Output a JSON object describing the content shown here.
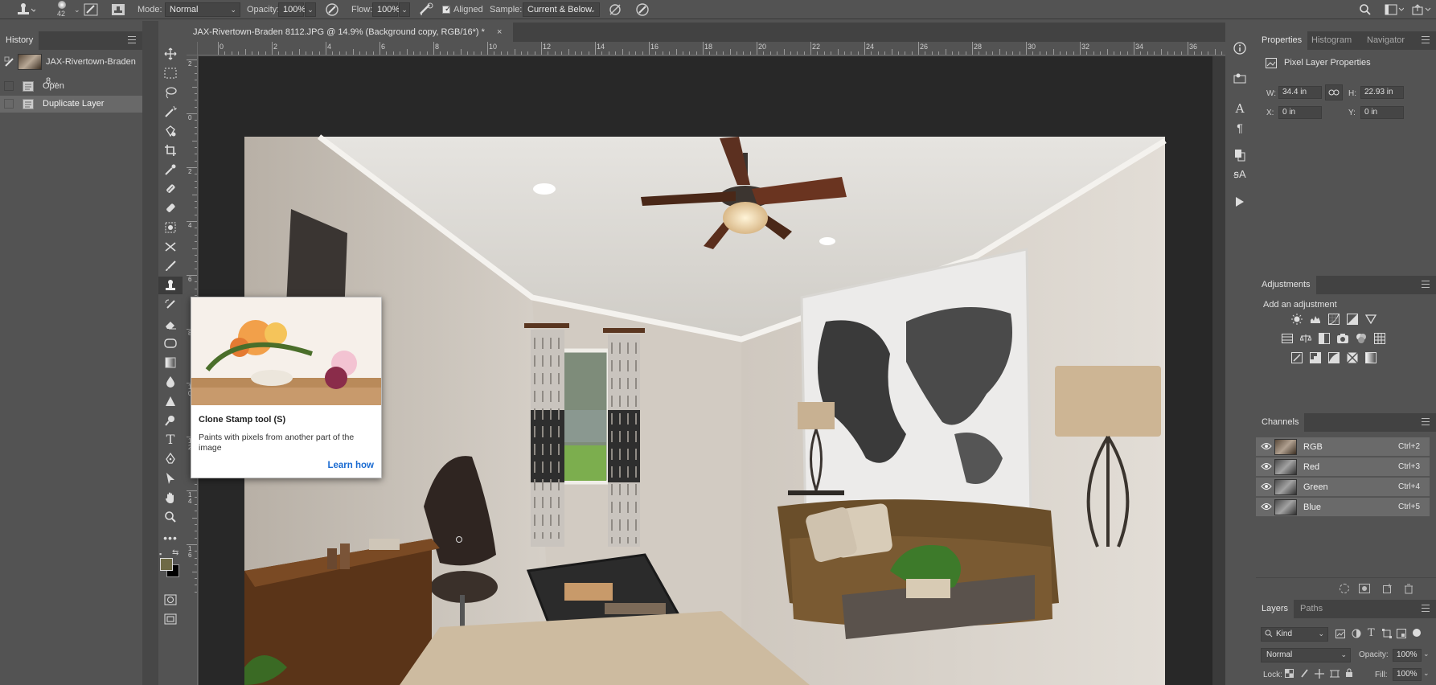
{
  "options_bar": {
    "brush_size": "42",
    "mode_label": "Mode:",
    "mode_value": "Normal",
    "opacity_label": "Opacity:",
    "opacity_value": "100%",
    "flow_label": "Flow:",
    "flow_value": "100%",
    "aligned_label": "Aligned",
    "aligned_checked": true,
    "sample_label": "Sample:",
    "sample_value": "Current & Below"
  },
  "history": {
    "tab_label": "History",
    "snapshot_label": "JAX-Rivertown-Braden 8...",
    "items": [
      {
        "label": "Open"
      },
      {
        "label": "Duplicate Layer",
        "selected": true
      }
    ]
  },
  "document": {
    "tab_title": "JAX-Rivertown-Braden 8112.JPG @ 14.9% (Background copy, RGB/16*) *",
    "close_glyph": "×",
    "ruler_top": [
      "0",
      "2",
      "4",
      "6",
      "8",
      "10",
      "12",
      "14",
      "16",
      "18",
      "20",
      "22",
      "24",
      "26",
      "28",
      "30",
      "32",
      "34",
      "36"
    ],
    "ruler_left": [
      "2",
      "0",
      "2",
      "4",
      "6",
      "8",
      "10",
      "12",
      "14",
      "16"
    ]
  },
  "tooltip": {
    "title": "Clone Stamp tool (S)",
    "body": "Paints with pixels from another part of the image",
    "link": "Learn how"
  },
  "properties": {
    "tabs": [
      "Properties",
      "Histogram",
      "Navigator"
    ],
    "header": "Pixel Layer Properties",
    "w_label": "W:",
    "w_value": "34.4 in",
    "h_label": "H:",
    "h_value": "22.93 in",
    "x_label": "X:",
    "x_value": "0 in",
    "y_label": "Y:",
    "y_value": "0 in"
  },
  "adjustments": {
    "tab": "Adjustments",
    "add_label": "Add an adjustment"
  },
  "channels": {
    "tab": "Channels",
    "rows": [
      {
        "name": "RGB",
        "shortcut": "Ctrl+2"
      },
      {
        "name": "Red",
        "shortcut": "Ctrl+3"
      },
      {
        "name": "Green",
        "shortcut": "Ctrl+4"
      },
      {
        "name": "Blue",
        "shortcut": "Ctrl+5"
      }
    ]
  },
  "layers": {
    "tabs": [
      "Layers",
      "Paths"
    ],
    "kind_label": "Kind",
    "blend_value": "Normal",
    "opacity_label": "Opacity:",
    "opacity_value": "100%",
    "lock_label": "Lock:",
    "fill_label": "Fill:",
    "fill_value": "100%"
  },
  "colors": {
    "foreground": "#6e6a45",
    "background": "#000000",
    "accent_link": "#1a6bd1"
  }
}
